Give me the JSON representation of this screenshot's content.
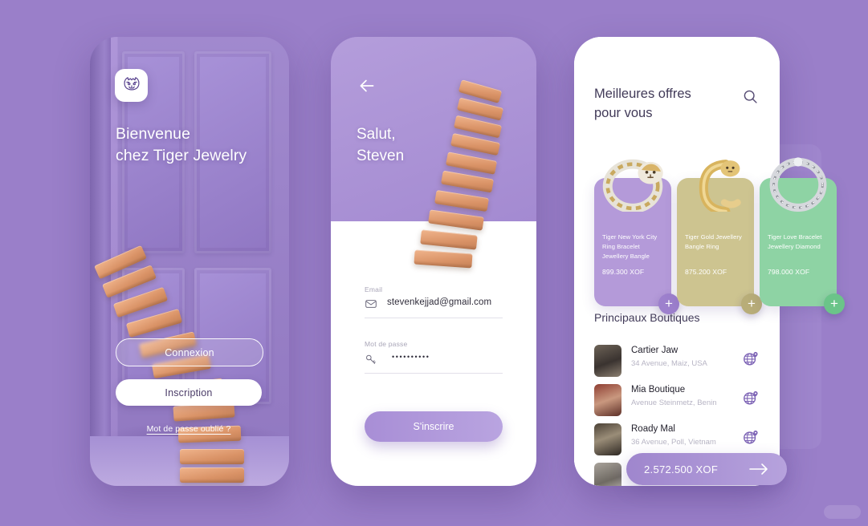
{
  "background_color": "#9a7fc9",
  "screen_login": {
    "logo_icon": "tiger-head-logo",
    "welcome_line1": "Bienvenue",
    "welcome_line2": "chez Tiger Jewelry",
    "login_button": "Connexion",
    "signup_button": "Inscription",
    "forgot_password": "Mot de passe oublié ?"
  },
  "screen_signup": {
    "back_icon": "arrow-left-icon",
    "greeting_line1": "Salut,",
    "greeting_line2": "Steven",
    "email_label": "Email",
    "email_icon": "envelope-icon",
    "email_value": "stevenkejjad@gmail.com",
    "password_label": "Mot de passe",
    "password_icon": "key-icon",
    "password_value": "••••••••••",
    "submit_button": "S'inscrire"
  },
  "screen_offers": {
    "title_line1": "Meilleures offres",
    "title_line2": "pour vous",
    "search_icon": "search-icon",
    "products": [
      {
        "name_line1": "Tiger New York City",
        "name_line2": "Ring Bracelet",
        "name_line3": "Jewellery Bangle",
        "price": "899.300 XOF",
        "card_color": "#b49ad9",
        "plus_color": "#9d80cd",
        "add_icon": "plus-icon",
        "image": "tiger-ring-silver-gold"
      },
      {
        "name_line1": "Tiger Gold Jewellery",
        "name_line2": "Bangle Ring",
        "name_line3": "",
        "price": "875.200 XOF",
        "card_color": "#cdc490",
        "plus_color": "#b8ad78",
        "add_icon": "plus-icon",
        "image": "tiger-gold-bangle"
      },
      {
        "name_line1": "Tiger Love Bracelet",
        "name_line2": "Jewellery Diamond",
        "name_line3": "",
        "price": "798.000 XOF",
        "card_color": "#8ed3a4",
        "plus_color": "#6bc489",
        "add_icon": "plus-icon",
        "image": "diamond-bracelet-silver"
      }
    ],
    "boutiques_title": "Principaux Boutiques",
    "boutiques": [
      {
        "name": "Cartier Jaw",
        "address": "34 Avenue, Maiz, USA",
        "globe_icon": "globe-pin-icon",
        "thumb": "storefront-photo-1"
      },
      {
        "name": "Mia Boutique",
        "address": "Avenue Steinmetz, Benin",
        "globe_icon": "globe-pin-icon",
        "thumb": "storefront-photo-2"
      },
      {
        "name": "Roady Mal",
        "address": "36 Avenue, Poll, Vietnam",
        "globe_icon": "globe-pin-icon",
        "thumb": "storefront-photo-3"
      },
      {
        "name": "",
        "address": "",
        "globe_icon": "globe-pin-icon",
        "thumb": "storefront-photo-4"
      }
    ],
    "total_price": "2.572.500 XOF",
    "total_arrow_icon": "arrow-right-icon"
  }
}
